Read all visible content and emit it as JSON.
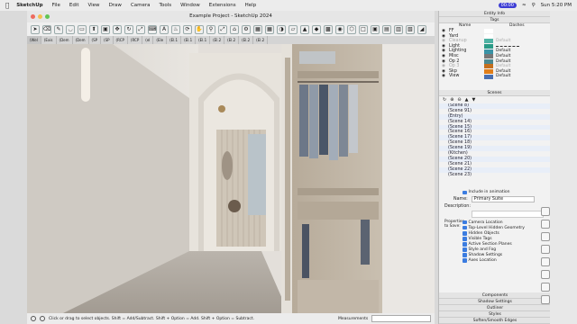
{
  "menubar": {
    "app": "SketchUp",
    "items": [
      "File",
      "Edit",
      "View",
      "Draw",
      "Camera",
      "Tools",
      "Window",
      "Extensions",
      "Help"
    ],
    "recording": "00:00",
    "clock": "Sun 5:20 PM"
  },
  "window_title": "Example Project - SketchUp 2024",
  "scene_tabs": [
    "(Wel",
    "(Exis",
    "(Dem",
    "(Dem",
    "(SP",
    "(SP",
    "(RCP",
    "(RCP",
    "(el",
    "(Ele",
    "(El.1",
    "(El.1",
    "(El.1",
    "(El.2",
    "(El.2",
    "(El.2",
    "(El.2"
  ],
  "entity_info": {
    "title": "Entity Info"
  },
  "tags": {
    "title": "Tags",
    "col_name": "Name",
    "col_dashes": "Dashes",
    "rows": [
      {
        "name": "FF",
        "dashes": "",
        "color": "#ffffff",
        "dim": false
      },
      {
        "name": "Yard",
        "dashes": "",
        "color": "#ffffff",
        "dim": false
      },
      {
        "name": "Cleanup",
        "dashes": "Default",
        "color": "#4fb2a4",
        "dim": true
      },
      {
        "name": "Light",
        "dashes": "dashed",
        "color": "#2a9a86",
        "dim": false
      },
      {
        "name": "Lighting",
        "dashes": "Default",
        "color": "#3a93a6",
        "dim": false
      },
      {
        "name": "Misc",
        "dashes": "Default",
        "color": "#777777",
        "dim": false
      },
      {
        "name": "Op 2",
        "dashes": "Default",
        "color": "#4a8890",
        "dim": false
      },
      {
        "name": "Op 3",
        "dashes": "Default",
        "color": "#c46f1e",
        "dim": true
      },
      {
        "name": "Skp",
        "dashes": "Default",
        "color": "#e07e1a",
        "dim": false
      },
      {
        "name": "View",
        "dashes": "Default",
        "color": "#4a6fb0",
        "dim": false
      }
    ]
  },
  "scenes": {
    "title": "Scenes",
    "list": [
      "(Scene 8)",
      "(Scene 91)",
      "(Entry)",
      "(Scene 14)",
      "(Scene 15)",
      "(Scene 16)",
      "(Scene 17)",
      "(Scene 18)",
      "(Scene 19)",
      "(Kitchen)",
      "(Scene 20)",
      "(Scene 21)",
      "(Scene 22)",
      "(Scene 23)"
    ],
    "include_label": "Include in animation",
    "name_label": "Name:",
    "name_value": "Primary Suite",
    "description_label": "Description:",
    "properties_label": "Properties to Save:",
    "properties": [
      "Camera Location",
      "Top-Level Hidden Geometry",
      "Hidden Objects",
      "Visible Tags",
      "Active Section Planes",
      "Style and Fog",
      "Shadow Settings",
      "Axes Location"
    ]
  },
  "collapsed_panels": [
    "Components",
    "Shadow Settings",
    "Outliner",
    "Styles",
    "Soften/Smooth Edges"
  ],
  "status": {
    "hint": "Click or drag to select objects. Shift = Add/Subtract. Shift + Option = Add. Shift + Option = Subtract.",
    "measurements_label": "Measurements"
  }
}
